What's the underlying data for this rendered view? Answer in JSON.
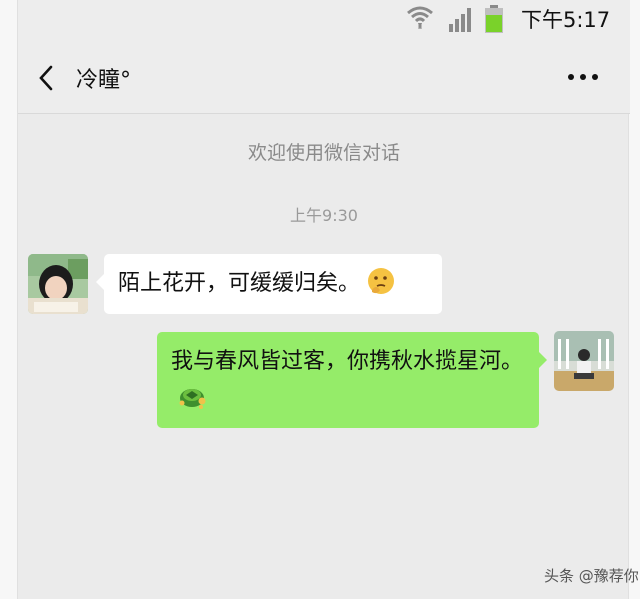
{
  "status_bar": {
    "time": "下午5:17",
    "icons": [
      "wifi-icon",
      "signal-icon",
      "battery-icon"
    ],
    "battery_color": "#7ad22a"
  },
  "header": {
    "title": "冷瞳°",
    "back_icon": "chevron-left-icon",
    "more_icon": "more-dots-icon"
  },
  "chat": {
    "system_message": "欢迎使用微信对话",
    "timestamp": "上午9:30",
    "messages": [
      {
        "sender": "other",
        "text": "陌上花开，可缓缓归矣。",
        "emoji": "thinking-face-emoji"
      },
      {
        "sender": "self",
        "text": "我与春风皆过客，你携秋水揽星河。",
        "emoji": "turtle-emoji"
      }
    ]
  },
  "watermark": "头条 @豫荐你",
  "colors": {
    "chat_background": "#ebebeb",
    "self_bubble": "#95ec69",
    "other_bubble": "#ffffff"
  }
}
